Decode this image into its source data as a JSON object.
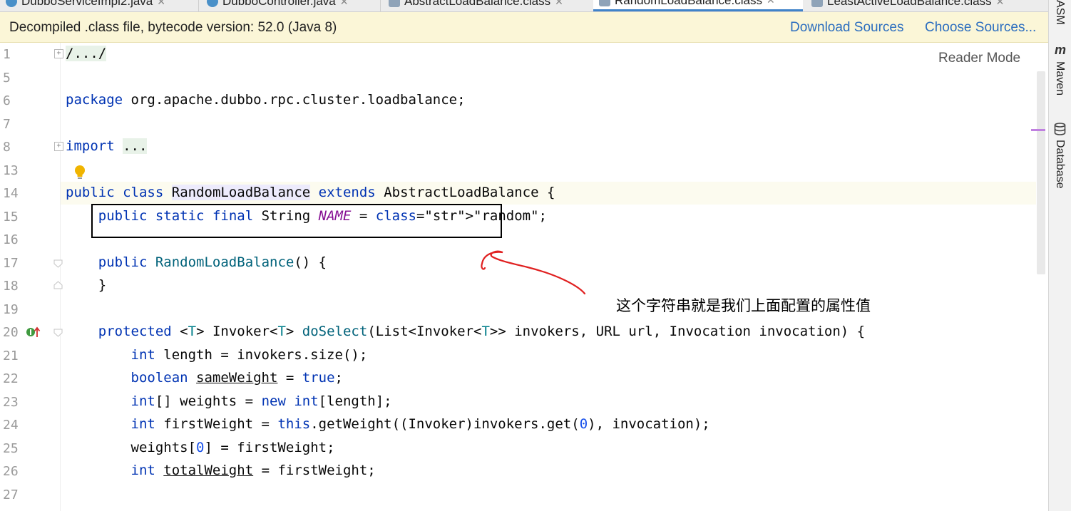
{
  "tabs": [
    {
      "label": "DubboServiceImpl2.java",
      "kind": "java"
    },
    {
      "label": "DubboController.java",
      "kind": "java"
    },
    {
      "label": "AbstractLoadBalance.class",
      "kind": "class"
    },
    {
      "label": "RandomLoadBalance.class",
      "kind": "class",
      "active": true
    },
    {
      "label": "LeastActiveLoadBalance.class",
      "kind": "class"
    }
  ],
  "banner": {
    "message": "Decompiled .class file, bytecode version: 52.0 (Java 8)",
    "download_sources": "Download Sources",
    "choose_sources": "Choose Sources..."
  },
  "editor": {
    "reader_mode": "Reader Mode",
    "lines": [
      {
        "num": "1",
        "text": "/.../"
      },
      {
        "num": "5",
        "text": ""
      },
      {
        "num": "6",
        "text": "package org.apache.dubbo.rpc.cluster.loadbalance;"
      },
      {
        "num": "7",
        "text": ""
      },
      {
        "num": "8",
        "text": "import ..."
      },
      {
        "num": "13",
        "text": ""
      },
      {
        "num": "14",
        "text": "public class RandomLoadBalance extends AbstractLoadBalance {"
      },
      {
        "num": "15",
        "text": "    public static final String NAME = \"random\";"
      },
      {
        "num": "16",
        "text": ""
      },
      {
        "num": "17",
        "text": "    public RandomLoadBalance() {"
      },
      {
        "num": "18",
        "text": "    }"
      },
      {
        "num": "19",
        "text": ""
      },
      {
        "num": "20",
        "text": "    protected <T> Invoker<T> doSelect(List<Invoker<T>> invokers, URL url, Invocation invocation) {"
      },
      {
        "num": "21",
        "text": "        int length = invokers.size();"
      },
      {
        "num": "22",
        "text": "        boolean sameWeight = true;"
      },
      {
        "num": "23",
        "text": "        int[] weights = new int[length];"
      },
      {
        "num": "24",
        "text": "        int firstWeight = this.getWeight((Invoker)invokers.get(0), invocation);"
      },
      {
        "num": "25",
        "text": "        weights[0] = firstWeight;"
      },
      {
        "num": "26",
        "text": "        int totalWeight = firstWeight;"
      },
      {
        "num": "27",
        "text": ""
      }
    ]
  },
  "tool_strip": {
    "asm": "ASM",
    "maven": "Maven",
    "database": "Database"
  },
  "annotation": {
    "text": "这个字符串就是我们上面配置的属性值"
  }
}
